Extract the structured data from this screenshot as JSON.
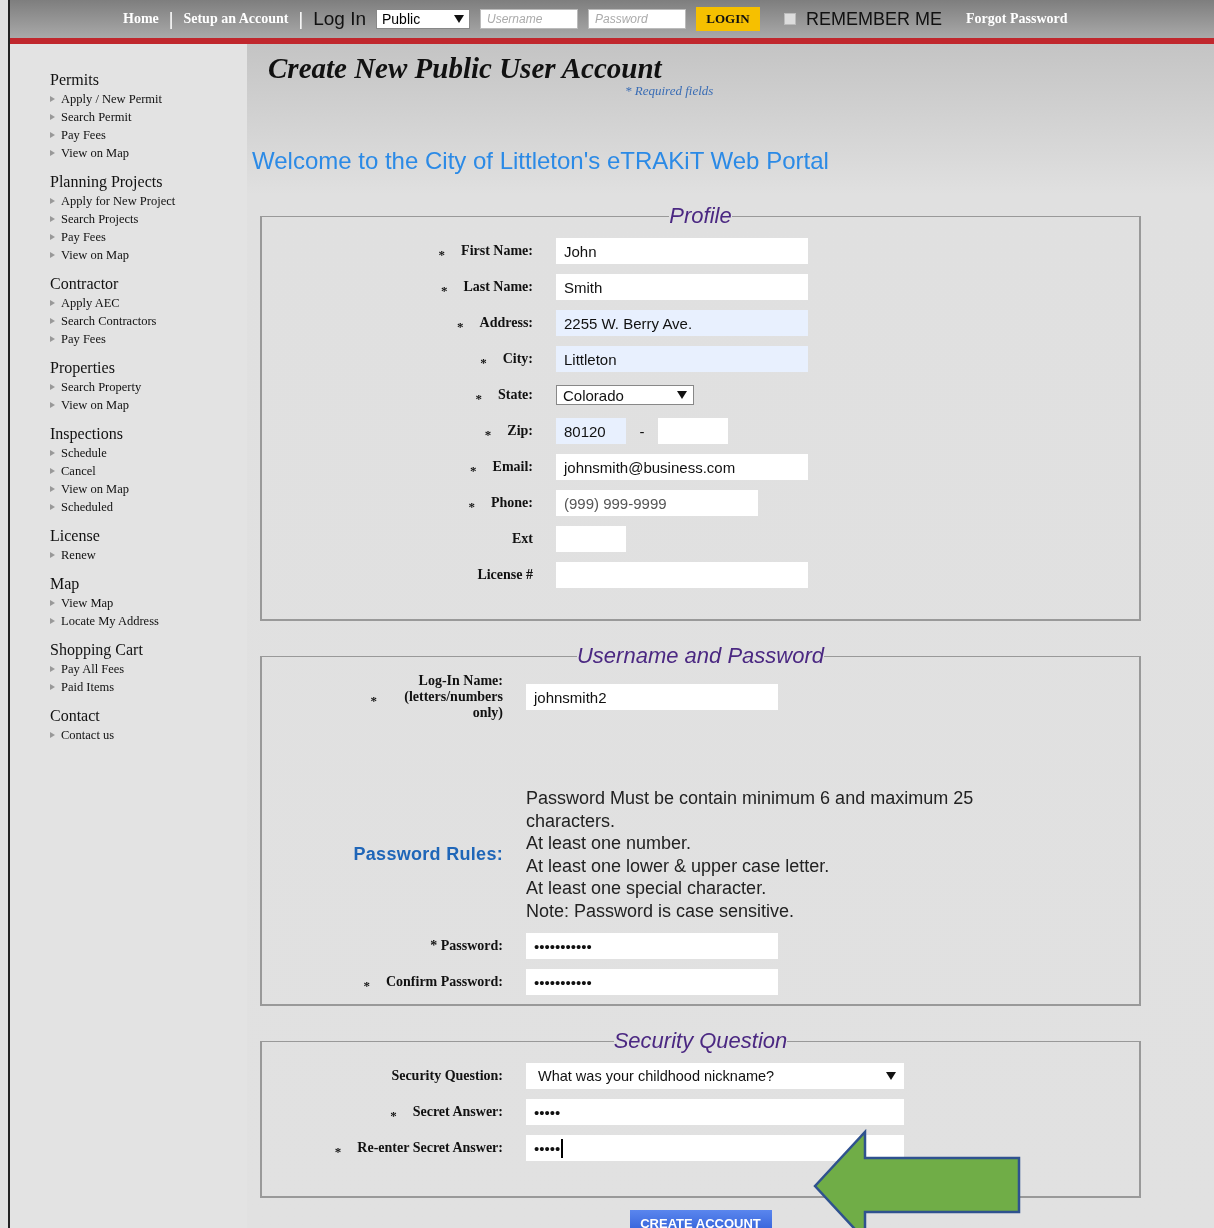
{
  "top_nav": {
    "links": [
      {
        "label": "Home",
        "separator": "|"
      },
      {
        "label": "Setup an Account",
        "separator": "|"
      }
    ],
    "login_label": "Log In",
    "account_type": "Public",
    "username": {
      "placeholder": "Username"
    },
    "password": {
      "placeholder": "Password"
    },
    "login_button": "LOGIN",
    "remember_me": {
      "label": "REMEMBER ME",
      "checked": false
    },
    "forgot_link": "Forgot Password"
  },
  "sidebar": [
    {
      "title": "Permits",
      "items": [
        "Apply / New Permit",
        "Search Permit",
        "Pay Fees",
        "View on Map"
      ]
    },
    {
      "title": "Planning Projects",
      "items": [
        "Apply for New Project",
        "Search Projects",
        "Pay Fees",
        "View on Map"
      ]
    },
    {
      "title": "Contractor",
      "items": [
        "Apply AEC",
        "Search Contractors",
        "Pay Fees"
      ]
    },
    {
      "title": "Properties",
      "items": [
        "Search Property",
        "View on Map"
      ]
    },
    {
      "title": "Inspections",
      "items": [
        "Schedule",
        "Cancel",
        "View on Map",
        "Scheduled"
      ]
    },
    {
      "title": "License",
      "items": [
        "Renew"
      ]
    },
    {
      "title": "Map",
      "items": [
        "View Map",
        "Locate My Address"
      ]
    },
    {
      "title": "Shopping Cart",
      "items": [
        "Pay All Fees",
        "Paid Items"
      ]
    },
    {
      "title": "Contact",
      "items": [
        "Contact us"
      ]
    }
  ],
  "page": {
    "title": "Create New Public User Account",
    "required_note": "* Required fields",
    "welcome": "Welcome to the City of Littleton's eTRAKiT Web Portal"
  },
  "sections": [
    {
      "kind": "profile",
      "legend": "Profile",
      "fields": [
        {
          "mark": "*",
          "label": "First Name:",
          "kind": "text",
          "value": "John",
          "autofilled": false
        },
        {
          "mark": "*",
          "label": "Last Name:",
          "kind": "text",
          "value": "Smith",
          "autofilled": false
        },
        {
          "mark": "*",
          "label": "Address:",
          "kind": "text",
          "value": "2255 W. Berry Ave.",
          "autofilled": true
        },
        {
          "mark": "*",
          "label": "City:",
          "kind": "text",
          "value": "Littleton",
          "autofilled": true
        },
        {
          "mark": "*",
          "label": "State:",
          "kind": "select",
          "value": "Colorado"
        },
        {
          "mark": "*",
          "label": "Zip:",
          "kind": "zip",
          "value": "80120",
          "autofilled": true,
          "separator": "-"
        },
        {
          "mark": "*",
          "label": "Email:",
          "kind": "text",
          "value": "johnsmith@business.com",
          "autofilled": false
        },
        {
          "mark": "*",
          "label": "Phone:",
          "kind": "phone",
          "placeholder": "(999) 999-9999",
          "autofilled": false
        },
        {
          "label": "Ext",
          "kind": "short",
          "autofilled": false
        },
        {
          "label": "License #",
          "kind": "text",
          "autofilled": false
        }
      ]
    },
    {
      "kind": "credentials",
      "legend": "Username and Password",
      "fields": [
        {
          "mark": "*",
          "label": "Log-In Name: (letters/numbers only)",
          "kind": "text",
          "value": "johnsmith2",
          "autofilled": false
        },
        {
          "label": "Password Rules:",
          "kind": "rules",
          "lines": [
            "Password Must be contain minimum 6 and maximum 25 characters.",
            "At least one number.",
            "At least one lower & upper case letter.",
            "At least one special character.",
            "Note: Password is case sensitive."
          ]
        },
        {
          "label": "* Password:",
          "kind": "text",
          "value": "•••••••••••",
          "autofilled": false
        },
        {
          "mark": "*",
          "label": "Confirm Password:",
          "kind": "text",
          "value": "•••••••••••",
          "autofilled": false
        }
      ]
    },
    {
      "kind": "security",
      "legend": "Security Question",
      "fields": [
        {
          "label": "Security Question:",
          "kind": "select",
          "value": "What was your childhood nickname?"
        },
        {
          "mark": "*",
          "label": "Secret Answer:",
          "kind": "text",
          "value": "•••••",
          "autofilled": false,
          "focused": false
        },
        {
          "mark": "*",
          "label": "Re-enter Secret Answer:",
          "kind": "text",
          "value": "•••••",
          "autofilled": false,
          "focused": true
        }
      ]
    }
  ],
  "submit_button": "CREATE ACCOUNT"
}
